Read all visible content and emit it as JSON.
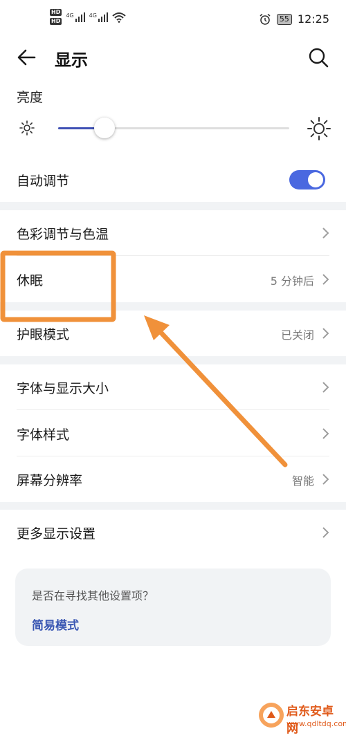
{
  "status_bar": {
    "hd_badges": [
      "HD",
      "HD"
    ],
    "signal_labels": [
      "4G",
      "4G"
    ],
    "battery": "55",
    "time": "12:25"
  },
  "header": {
    "title": "显示"
  },
  "brightness": {
    "label": "亮度",
    "level_fraction": 0.2
  },
  "auto_adjust": {
    "label": "自动调节",
    "enabled": true
  },
  "rows": {
    "color_temp": {
      "label": "色彩调节与色温",
      "value": ""
    },
    "sleep": {
      "label": "休眠",
      "value": "5 分钟后"
    },
    "eye_comfort": {
      "label": "护眼模式",
      "value": "已关闭"
    },
    "font_size": {
      "label": "字体与显示大小",
      "value": ""
    },
    "font_style": {
      "label": "字体样式",
      "value": ""
    },
    "resolution": {
      "label": "屏幕分辨率",
      "value": "智能"
    },
    "more": {
      "label": "更多显示设置",
      "value": ""
    }
  },
  "help_card": {
    "question": "是否在寻找其他设置项？",
    "link": "简易模式"
  },
  "watermark": {
    "title": "启东安卓网",
    "url": "www.qdltdq.com"
  },
  "colors": {
    "accent": "#4a68e0",
    "annotation": "#f0913a",
    "link": "#3a57b3"
  }
}
